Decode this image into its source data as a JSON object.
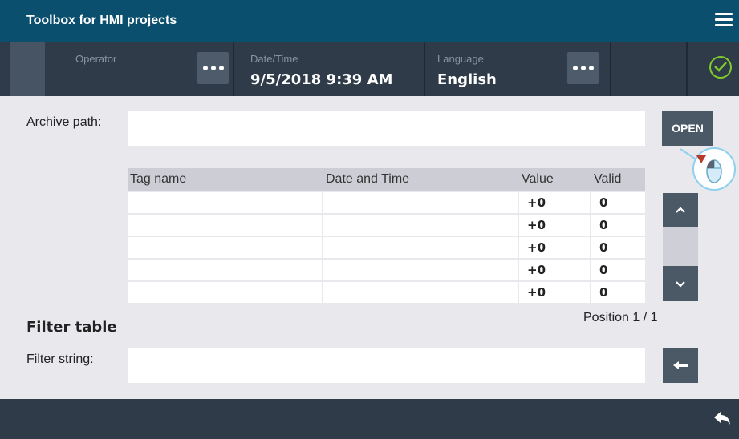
{
  "title_bar": {
    "title": "Toolbox for HMI projects",
    "menu_icon": "hamburger-menu-icon"
  },
  "status_bar": {
    "operator_caption": "Operator",
    "operator_value": "",
    "datetime_caption": "Date/Time",
    "datetime_value": "9/5/2018 9:39 AM",
    "language_caption": "Language",
    "language_value": "English",
    "status_icon": "check-circle-icon",
    "status_color": "#7fcc2a"
  },
  "archive": {
    "label": "Archive path:",
    "value": "",
    "open_label": "OPEN"
  },
  "table": {
    "headers": [
      "Tag name",
      "Date and Time",
      "Value",
      "Valid"
    ],
    "rows": [
      [
        "",
        "",
        "+0",
        "0"
      ],
      [
        "",
        "",
        "+0",
        "0"
      ],
      [
        "",
        "",
        "+0",
        "0"
      ],
      [
        "",
        "",
        "+0",
        "0"
      ],
      [
        "",
        "",
        "+0",
        "0"
      ]
    ]
  },
  "scroll": {
    "up_icon": "chevron-up-icon",
    "down_icon": "chevron-down-icon"
  },
  "position": "Position 1 / 1",
  "filter": {
    "title": "Filter table",
    "label": "Filter string:",
    "value": "",
    "button_icon": "arrow-left-icon"
  },
  "bottom_bar": {
    "back_icon": "back-arrow-icon"
  },
  "colors": {
    "header_bg": "#0a4f6e",
    "status_bg": "#2f3b48",
    "button_bg": "#4b5866",
    "page_bg": "#e8e8ed"
  }
}
